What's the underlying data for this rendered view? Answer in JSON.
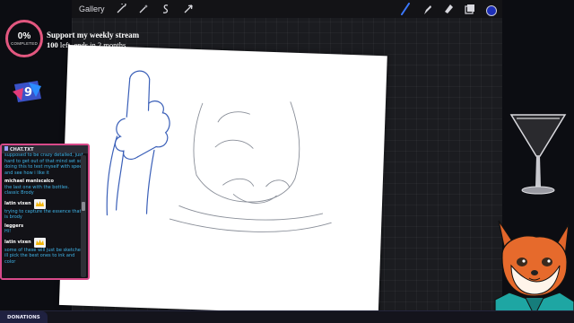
{
  "toolbar": {
    "gallery_label": "Gallery",
    "left_icons": [
      "wrench-icon",
      "magic-wand-icon",
      "selection-icon",
      "transform-arrow-icon"
    ],
    "right_icons": [
      "brush-icon",
      "smudge-icon",
      "eraser-icon",
      "layers-icon"
    ],
    "current_color": "#1d2fb8"
  },
  "goal": {
    "percent": "0%",
    "status": "COMPLETED",
    "title": "Support my weekly stream",
    "count": "100",
    "detail": " left, ends in 2 months",
    "ring_color": "#e2577f"
  },
  "logo": {
    "number": "9"
  },
  "chat": {
    "header": "CHAT.TXT",
    "top_fragment": "supposed to be crazy detailed, just hard to get out of that mind set so doing this to test myself with speed and see how i like it",
    "messages": [
      {
        "user": "michael maniscalco",
        "badge": false,
        "text": "the last one with the bottles. classic Brody"
      },
      {
        "user": "latin vixen",
        "badge": true,
        "text": "trying to capture the essence that is brody"
      },
      {
        "user": "leggers",
        "badge": false,
        "text": "Hi!"
      },
      {
        "user": "latin vixen",
        "badge": true,
        "text": "some of these will just be sketches ill pick the best ones to ink and color"
      }
    ],
    "border_color": "#d84a8a",
    "message_color": "#3fb4e8"
  },
  "bottom": {
    "donations_label": "DONATIONS"
  }
}
